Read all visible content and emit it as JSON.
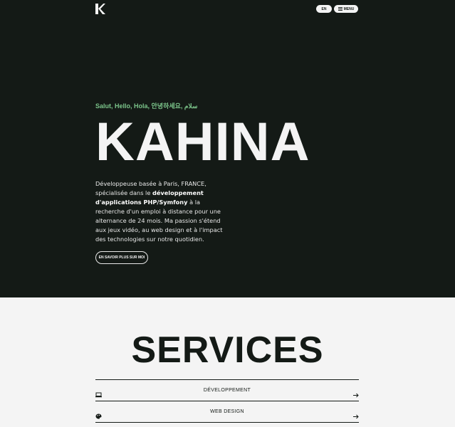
{
  "header": {
    "logo_icon": "k-logo-icon",
    "lang_label": "EN",
    "menu_label": "MENU",
    "menu_icon": "hamburger-icon"
  },
  "hero": {
    "greeting": "Salut, Hello, Hola, 안녕하세요, سلام",
    "name": "KAHINA",
    "intro_part1": "Développeuse basée à Paris, FRANCE, spécialisée dans le ",
    "intro_bold": "développement d'applications PHP/Symfony",
    "intro_part2": " à la recherche d'un emploi à distance pour une alternance de 24 mois. Ma passion s'étend aux jeux vidéo, au web design et à l'impact des technologies sur notre quotidien.",
    "more_button": "EN SAVOIR PLUS SUR MOI"
  },
  "services": {
    "title": "SERVICES",
    "items": [
      {
        "label": "DÉVELOPPEMENT",
        "icon": "laptop-icon"
      },
      {
        "label": "WEB DESIGN",
        "icon": "palette-icon"
      }
    ]
  },
  "colors": {
    "dark": "#141a16",
    "light": "#f4f4f4",
    "accent_green": "#7bc48a"
  }
}
